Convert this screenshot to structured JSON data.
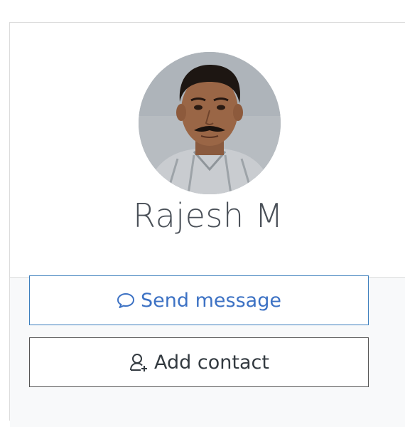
{
  "profile": {
    "name": "Rajesh M",
    "avatar": "person-photo"
  },
  "actions": {
    "send_message_label": "Send message",
    "send_message_icon": "speech-bubble-icon",
    "add_contact_label": "Add contact",
    "add_contact_icon": "user-add-icon"
  },
  "colors": {
    "send_message_accent": "#3d72c4",
    "add_contact_text": "#333a40",
    "name_text": "#4a5058"
  }
}
